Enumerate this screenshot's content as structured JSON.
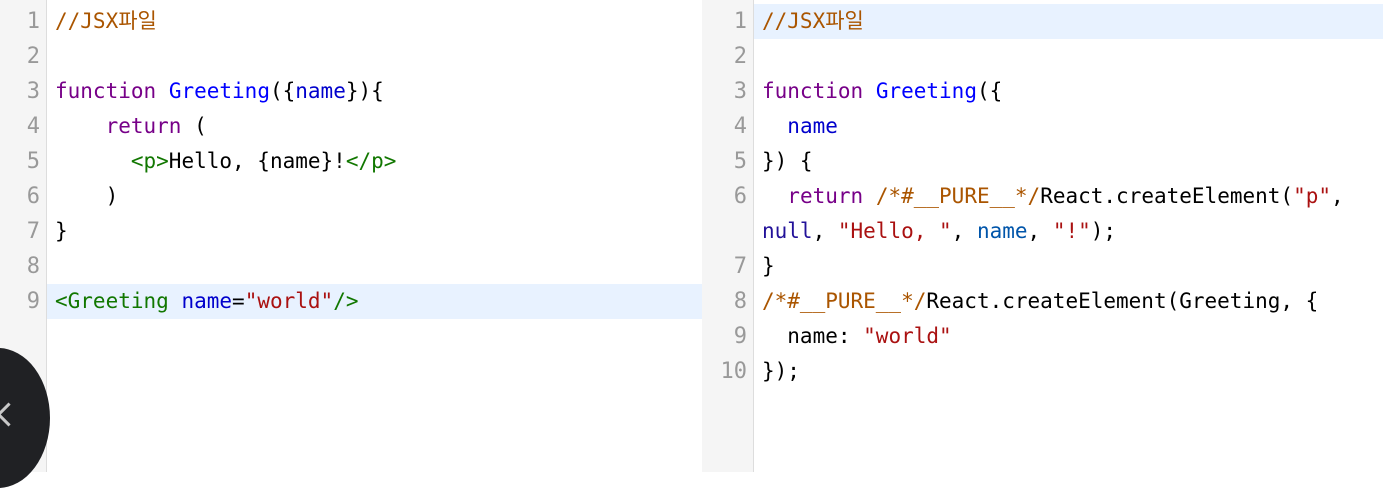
{
  "left_editor": {
    "line_numbers": [
      "1",
      "2",
      "3",
      "4",
      "5",
      "6",
      "7",
      "8",
      "9"
    ],
    "active_line": 9,
    "lines": [
      [
        {
          "t": "//JSX파일",
          "c": "comment"
        }
      ],
      [],
      [
        {
          "t": "function",
          "c": "keyword"
        },
        {
          "t": " "
        },
        {
          "t": "Greeting",
          "c": "def"
        },
        {
          "t": "({"
        },
        {
          "t": "name",
          "c": "prop"
        },
        {
          "t": "}){"
        }
      ],
      [
        {
          "t": "    "
        },
        {
          "t": "return",
          "c": "keyword"
        },
        {
          "t": " ("
        }
      ],
      [
        {
          "t": "      "
        },
        {
          "t": "<p>",
          "c": "tag"
        },
        {
          "t": "Hello, {name}!"
        },
        {
          "t": "</p>",
          "c": "tag"
        }
      ],
      [
        {
          "t": "    )"
        }
      ],
      [
        {
          "t": "}"
        }
      ],
      [],
      [
        {
          "t": "<Greeting",
          "c": "tag"
        },
        {
          "t": " "
        },
        {
          "t": "name",
          "c": "attr"
        },
        {
          "t": "="
        },
        {
          "t": "\"world\"",
          "c": "string"
        },
        {
          "t": "/>",
          "c": "tag"
        }
      ]
    ]
  },
  "right_editor": {
    "line_numbers": [
      "1",
      "2",
      "3",
      "4",
      "5",
      "6",
      "",
      "7",
      "8",
      "9",
      "10"
    ],
    "active_line": 1,
    "lines": [
      [
        {
          "t": "//JSX파일",
          "c": "comment"
        }
      ],
      [],
      [
        {
          "t": "function",
          "c": "keyword"
        },
        {
          "t": " "
        },
        {
          "t": "Greeting",
          "c": "def"
        },
        {
          "t": "({"
        }
      ],
      [
        {
          "t": "  "
        },
        {
          "t": "name",
          "c": "prop"
        }
      ],
      [
        {
          "t": "}) {"
        }
      ],
      [
        {
          "t": "  "
        },
        {
          "t": "return",
          "c": "keyword"
        },
        {
          "t": " "
        },
        {
          "t": "/*#__PURE__*/",
          "c": "comment"
        },
        {
          "t": "React.createElement("
        },
        {
          "t": "\"p\"",
          "c": "string"
        },
        {
          "t": ","
        }
      ],
      [
        {
          "t": "null",
          "c": "atom"
        },
        {
          "t": ", "
        },
        {
          "t": "\"Hello, \"",
          "c": "string"
        },
        {
          "t": ", "
        },
        {
          "t": "name",
          "c": "var2"
        },
        {
          "t": ", "
        },
        {
          "t": "\"!\"",
          "c": "string"
        },
        {
          "t": ");"
        }
      ],
      [
        {
          "t": "}"
        }
      ],
      [
        {
          "t": "/*#__PURE__*/",
          "c": "comment"
        },
        {
          "t": "React.createElement(Greeting, {"
        }
      ],
      [
        {
          "t": "  name: "
        },
        {
          "t": "\"world\"",
          "c": "string"
        }
      ],
      [
        {
          "t": "});"
        }
      ]
    ]
  },
  "icons": {
    "back": "chevron-left-icon"
  }
}
